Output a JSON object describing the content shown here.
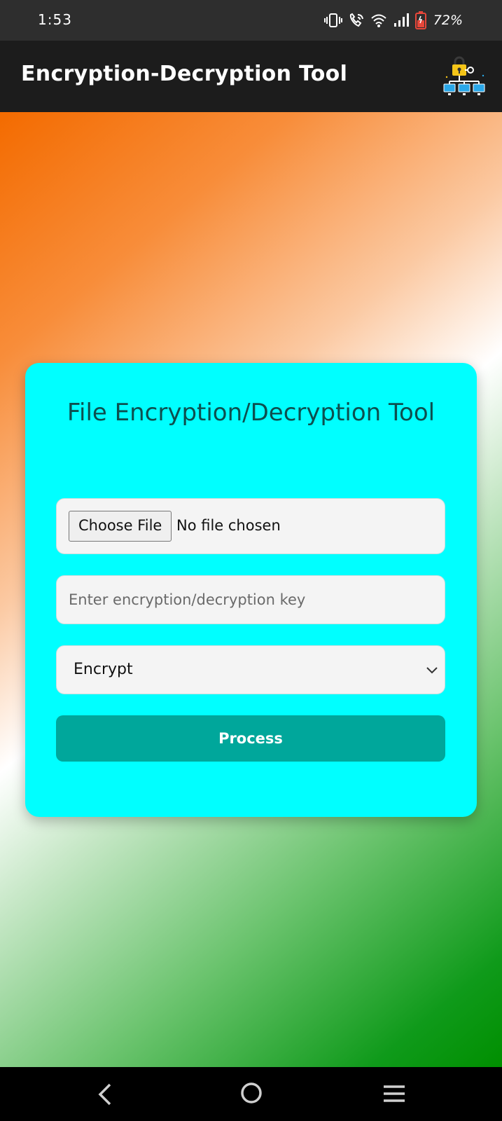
{
  "status_bar": {
    "time": "1:53",
    "battery_percent": "72%",
    "icons": [
      "vibrate-icon",
      "wifi-call-icon",
      "wifi-icon",
      "signal-icon",
      "battery-icon"
    ]
  },
  "app_bar": {
    "title": "Encryption-Decryption Tool",
    "logo_icon": "network-lock-icon"
  },
  "background": {
    "colors": [
      "#f36b00",
      "#ffffff",
      "#008f00"
    ]
  },
  "card": {
    "title": "File Encryption/Decryption Tool",
    "background_color": "#00ffff",
    "file_input": {
      "button_label": "Choose File",
      "status_text": "No file chosen"
    },
    "key_input": {
      "placeholder": "Enter encryption/decryption key",
      "value": ""
    },
    "mode_select": {
      "selected": "Encrypt",
      "icon": "chevron-down-icon"
    },
    "process_button": {
      "label": "Process",
      "color": "#00a79b"
    }
  },
  "nav_bar": {
    "icons": [
      "back-icon",
      "home-icon",
      "recents-icon"
    ]
  }
}
